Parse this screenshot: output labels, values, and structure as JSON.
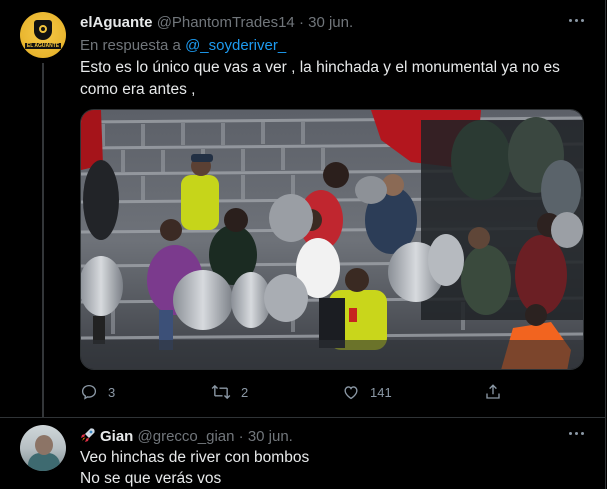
{
  "tweet": {
    "author_name": "elAguante",
    "author_handle": "@PhantomTrades14",
    "separator": "·",
    "date": "30 jun.",
    "avatar_label": "EL AGUANTE",
    "reply_prefix": "En respuesta a",
    "reply_mention": "@_soyderiver_",
    "text": "Esto es lo único que vas a ver , la hinchada y el monumental ya no es como era antes ,",
    "media_description_icon": "stadium-photo",
    "counts": {
      "replies": "3",
      "retweets": "2",
      "likes": "141"
    }
  },
  "reply": {
    "author_emoji": "🚀",
    "author_name": "Gian",
    "author_handle": "@grecco_gian",
    "separator": "·",
    "date": "30 jun.",
    "line1": "Veo hinchas de river con bombos",
    "line2": "No se que verás vos"
  },
  "icons": {
    "reply": "reply-icon",
    "retweet": "retweet-icon",
    "like": "heart-icon",
    "share": "share-icon",
    "more": "more-icon"
  },
  "colors": {
    "background": "#000000",
    "text": "#e7e9ea",
    "muted": "#71767b",
    "accent": "#1d9bf0",
    "border": "#2f3336"
  }
}
